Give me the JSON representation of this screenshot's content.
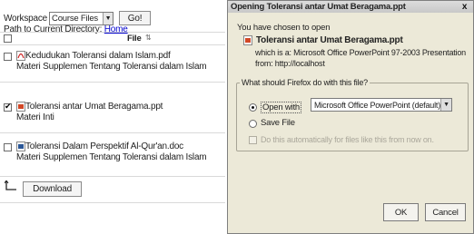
{
  "file_panel": {
    "workspace_label": "Workspace",
    "workspace_value": "Course Files",
    "go_label": "Go!",
    "path_label": "Path to Current Directory:",
    "path_link": "Home",
    "header": {
      "file_label": "File",
      "sort_icon": "sort-arrows-icon"
    },
    "files": [
      {
        "name": "Kedudukan Toleransi dalam Islam.pdf",
        "description": "Materi Supplemen Tentang Toleransi dalam Islam",
        "type": "pdf",
        "checked": false
      },
      {
        "name": "Toleransi antar Umat Beragama.ppt",
        "description": "Materi Inti",
        "type": "ppt",
        "checked": true
      },
      {
        "name": "Toleransi Dalam Perspektif Al-Qur'an.doc",
        "description": "Materi Supplemen Tentang Toleransi dalam Islam",
        "type": "doc",
        "checked": false
      }
    ],
    "download_label": "Download"
  },
  "dialog": {
    "title": "Opening Toleransi antar Umat Beragama.ppt",
    "intro": "You have chosen to open",
    "file_name": "Toleransi antar Umat Beragama.ppt",
    "which_is": "which is a:  Microsoft Office PowerPoint 97-2003 Presentation",
    "from": "from:  http://localhost",
    "group_legend": "What should Firefox do with this file?",
    "open_with_label": "Open with",
    "open_with_app": "Microsoft Office PowerPoint (default)",
    "save_label": "Save File",
    "auto_label": "Do this automatically for files like this from now on.",
    "ok_label": "OK",
    "cancel_label": "Cancel",
    "close_glyph": "x"
  },
  "colors": {
    "link": "#0000cc",
    "dialog_bg": "#ece9d8",
    "titlebar": "#d0d0d0"
  }
}
